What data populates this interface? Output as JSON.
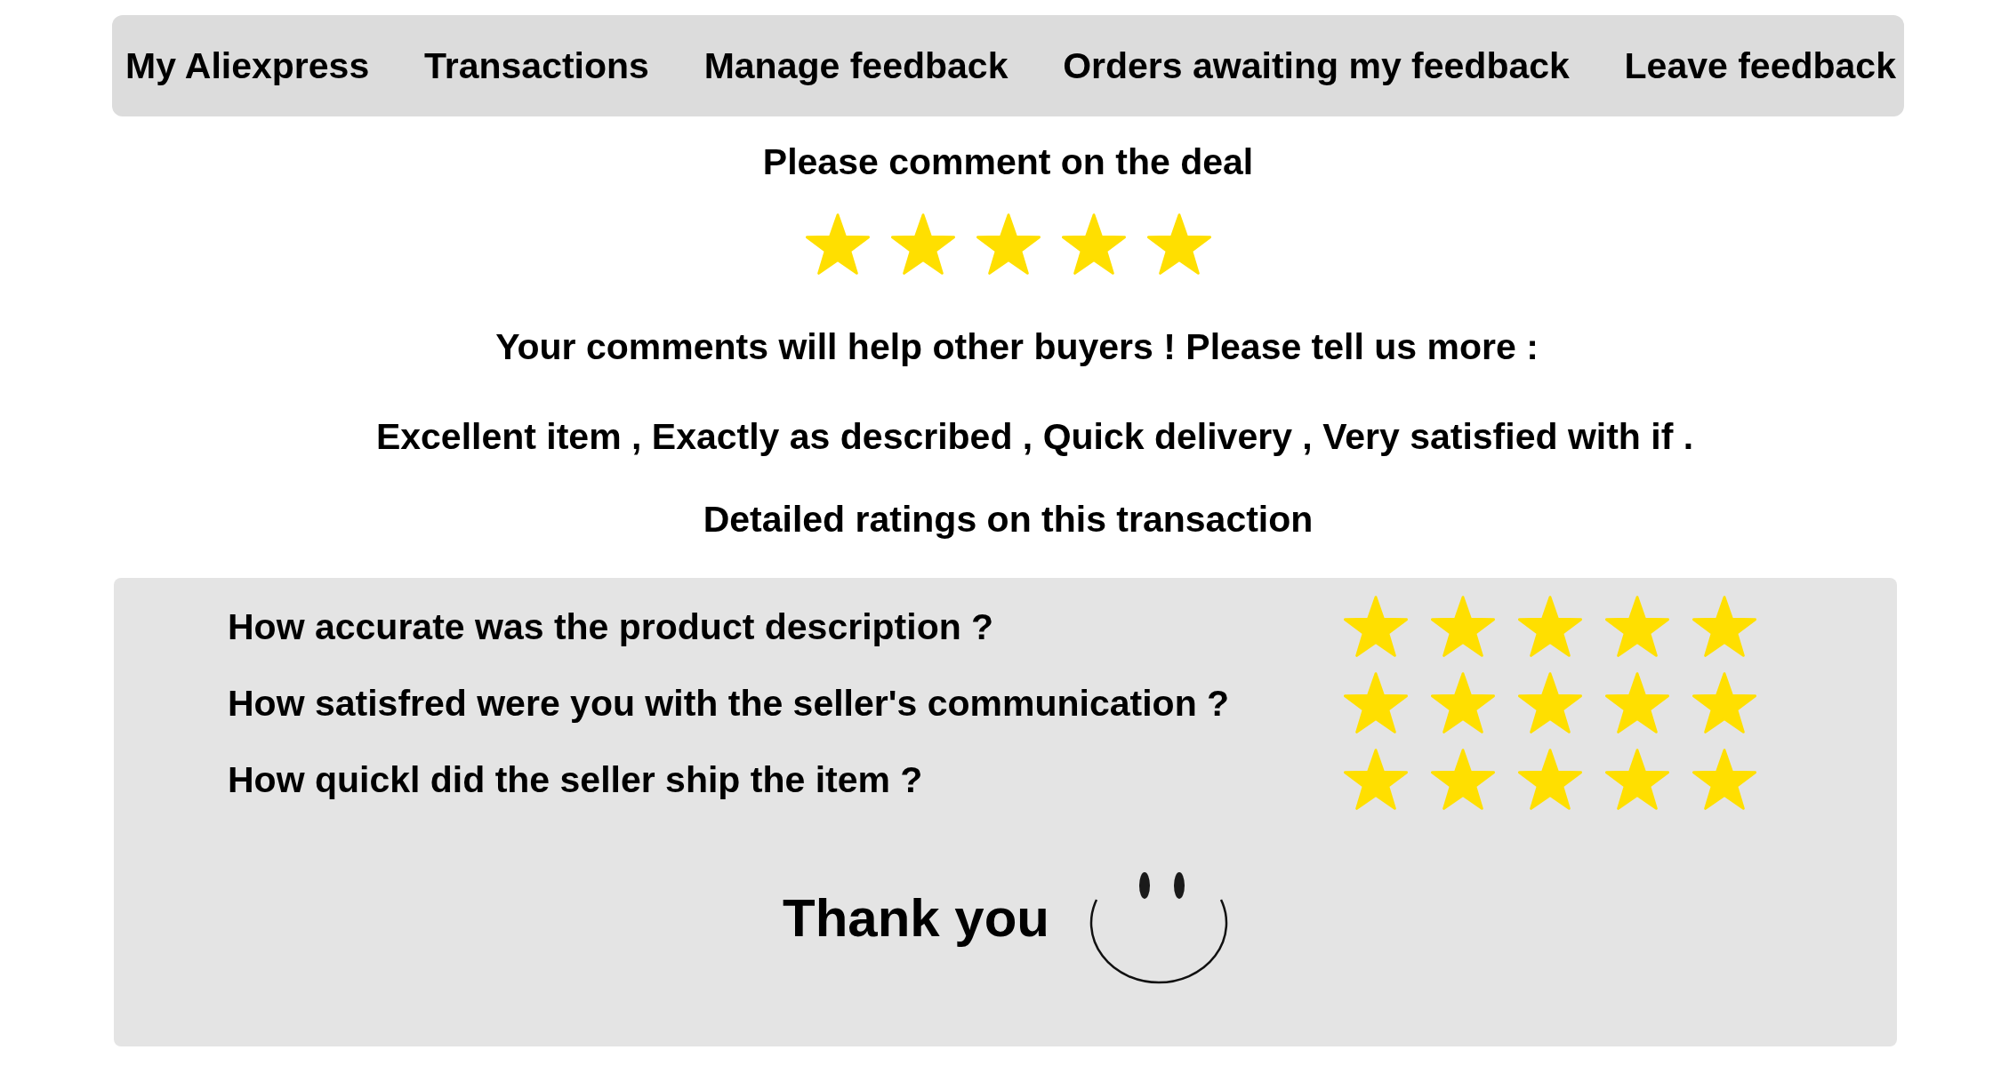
{
  "nav": {
    "items": [
      {
        "label": "My Aliexpress"
      },
      {
        "label": "Transactions"
      },
      {
        "label": "Manage feedback"
      },
      {
        "label": "Orders awaiting my feedback"
      },
      {
        "label": "Leave feedback"
      }
    ]
  },
  "overall_rating": {
    "prompt": "Please comment on the deal",
    "stars": 5
  },
  "comment_prompt": "Your comments will help other buyers ! Please tell us more :",
  "comment": "Excellent item , Exactly as described , Quick delivery , Very satisfied with if .",
  "detailed_ratings": {
    "title": "Detailed ratings on this transaction",
    "items": [
      {
        "question": "How accurate was the product description ?",
        "stars": 5
      },
      {
        "question": "How satisfred were you with the seller's communication ?",
        "stars": 5
      },
      {
        "question": "How quickl did the seller ship the item ?",
        "stars": 5
      }
    ]
  },
  "thank_you": "Thank you"
}
